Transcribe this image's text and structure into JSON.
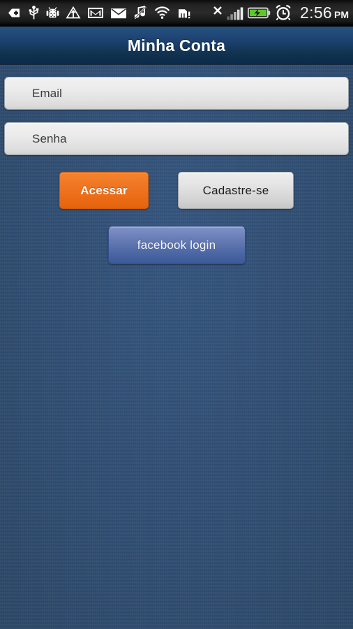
{
  "status_bar": {
    "icons": [
      {
        "name": "sd-card-icon",
        "label": "SD card"
      },
      {
        "name": "usb-icon",
        "label": "USB connected"
      },
      {
        "name": "android-debug-icon",
        "label": "USB debugging"
      },
      {
        "name": "upload-icon",
        "label": "Uploading"
      },
      {
        "name": "gmail-icon",
        "label": "Gmail"
      },
      {
        "name": "email-icon",
        "label": "Email"
      },
      {
        "name": "music-off-icon",
        "label": "Music muted"
      },
      {
        "name": "wifi-icon",
        "label": "Wi-Fi"
      },
      {
        "name": "sim-card-alert-icon",
        "label": "SIM card alert"
      },
      {
        "name": "no-signal-x-icon",
        "label": "No service"
      },
      {
        "name": "signal-bars-icon",
        "label": "Signal strength"
      },
      {
        "name": "battery-charging-icon",
        "label": "Battery charging"
      },
      {
        "name": "alarm-clock-icon",
        "label": "Alarm set"
      }
    ],
    "clock_time": "2:56",
    "clock_meridiem": "PM"
  },
  "title_bar": {
    "title": "Minha Conta"
  },
  "form": {
    "email_field": {
      "placeholder": "Email",
      "value": ""
    },
    "password_field": {
      "placeholder": "Senha",
      "value": ""
    }
  },
  "buttons": {
    "login": "Acessar",
    "register": "Cadastre-se",
    "facebook": "facebook login"
  },
  "colors": {
    "background": "#2c4a6e",
    "title_bar_top": "#27527f",
    "title_bar_bottom": "#0a2a49",
    "accent_orange": "#ef7320",
    "facebook_blue": "#3b5998",
    "field_background": "#ebebeb",
    "status_bar": "#222222"
  }
}
